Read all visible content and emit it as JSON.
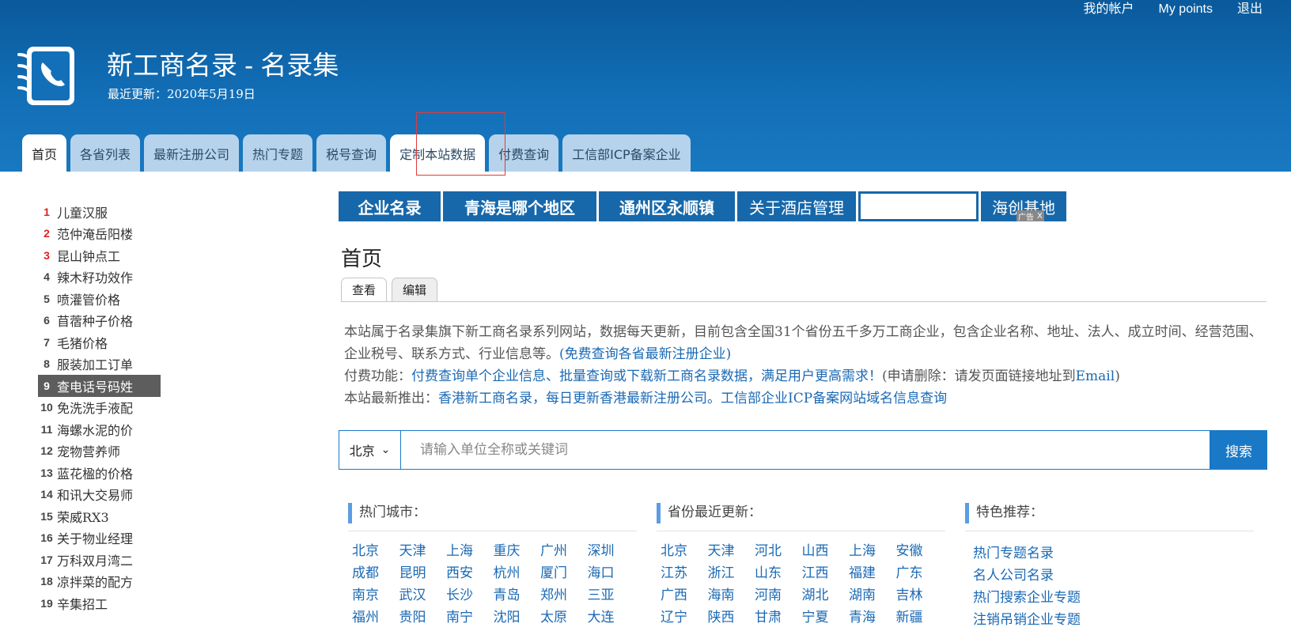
{
  "top_links": {
    "account": "我的帐户",
    "points": "My points",
    "logout": "退出"
  },
  "site": {
    "title": "新工商名录 - 名录集",
    "subtitle": "最近更新：2020年5月19日"
  },
  "nav": {
    "tabs": [
      {
        "label": "首页"
      },
      {
        "label": "各省列表"
      },
      {
        "label": "最新注册公司"
      },
      {
        "label": "热门专题"
      },
      {
        "label": "税号查询"
      },
      {
        "label": "定制本站数据"
      },
      {
        "label": "付费查询"
      },
      {
        "label": "工信部ICP备案企业"
      }
    ]
  },
  "sidebar": {
    "items": [
      {
        "rank": "1",
        "text": "儿童汉服"
      },
      {
        "rank": "2",
        "text": "范仲淹岳阳楼"
      },
      {
        "rank": "3",
        "text": "昆山钟点工"
      },
      {
        "rank": "4",
        "text": "辣木籽功效作"
      },
      {
        "rank": "5",
        "text": "喷灌管价格"
      },
      {
        "rank": "6",
        "text": "苜蓿种子价格"
      },
      {
        "rank": "7",
        "text": "毛猪价格"
      },
      {
        "rank": "8",
        "text": "服装加工订单"
      },
      {
        "rank": "9",
        "text": "查电话号码姓"
      },
      {
        "rank": "10",
        "text": "免洗洗手液配"
      },
      {
        "rank": "11",
        "text": "海螺水泥的价"
      },
      {
        "rank": "12",
        "text": "宠物营养师"
      },
      {
        "rank": "13",
        "text": "蓝花楹的价格"
      },
      {
        "rank": "14",
        "text": "和讯大交易师"
      },
      {
        "rank": "15",
        "text": "荣威RX3"
      },
      {
        "rank": "16",
        "text": "关于物业经理"
      },
      {
        "rank": "17",
        "text": "万科双月湾二"
      },
      {
        "rank": "18",
        "text": "凉拌菜的配方"
      },
      {
        "rank": "19",
        "text": "辛集招工"
      }
    ]
  },
  "ad": {
    "items": [
      "企业名录",
      "青海是哪个地区",
      "通州区永顺镇",
      "关于酒店管理",
      "海创基地"
    ],
    "badge": "广告",
    "close": "X"
  },
  "page": {
    "heading": "首页",
    "tabs": [
      "查看",
      "编辑"
    ]
  },
  "intro": {
    "p1": "本站属于名录集旗下新工商名录系列网站，数据每天更新，目前包含全国31个省份五千多万工商企业，包含企业名称、地址、法人、成立时间、经营范围、企业税号、联系方式、行业信息等。",
    "p1_link": "(免费查询各省最新注册企业)",
    "p2_prefix": "付费功能：",
    "p2_link": "付费查询单个企业信息、批量查询或下载新工商名录数据，满足用户更高需求！",
    "p2_mid": "(申请删除：请发页面链接地址到",
    "p2_email": "Email",
    "p2_suffix": ")",
    "p3_prefix": "本站最新推出：",
    "p3_link1": "香港新工商名录，每日更新香港最新注册公司。",
    "p3_link2": "工信部企业ICP备案网站域名信息查询"
  },
  "search": {
    "province": "北京",
    "placeholder": "请输入单位全称或关键词",
    "button": "搜索"
  },
  "sections": {
    "hot_cities": {
      "title": "热门城市：",
      "items": [
        "北京",
        "天津",
        "上海",
        "重庆",
        "广州",
        "深圳",
        "成都",
        "昆明",
        "西安",
        "杭州",
        "厦门",
        "海口",
        "南京",
        "武汉",
        "长沙",
        "青岛",
        "郑州",
        "三亚",
        "福州",
        "贵阳",
        "南宁",
        "沈阳",
        "太原",
        "大连"
      ]
    },
    "provinces": {
      "title": "省份最近更新：",
      "items": [
        "北京",
        "天津",
        "河北",
        "山西",
        "上海",
        "安徽",
        "江苏",
        "浙江",
        "山东",
        "江西",
        "福建",
        "广东",
        "广西",
        "海南",
        "河南",
        "湖北",
        "湖南",
        "吉林",
        "辽宁",
        "陕西",
        "甘肃",
        "宁夏",
        "青海",
        "新疆"
      ]
    },
    "featured": {
      "title": "特色推荐：",
      "items": [
        "热门专题名录",
        "名人公司名录",
        "热门搜索企业专题",
        "注销吊销企业专题"
      ]
    }
  },
  "colors": {
    "header_blue": "#1370b8",
    "link_blue": "#1a69b4",
    "ad_blue": "#1768aa",
    "rank_red": "#e02020"
  }
}
